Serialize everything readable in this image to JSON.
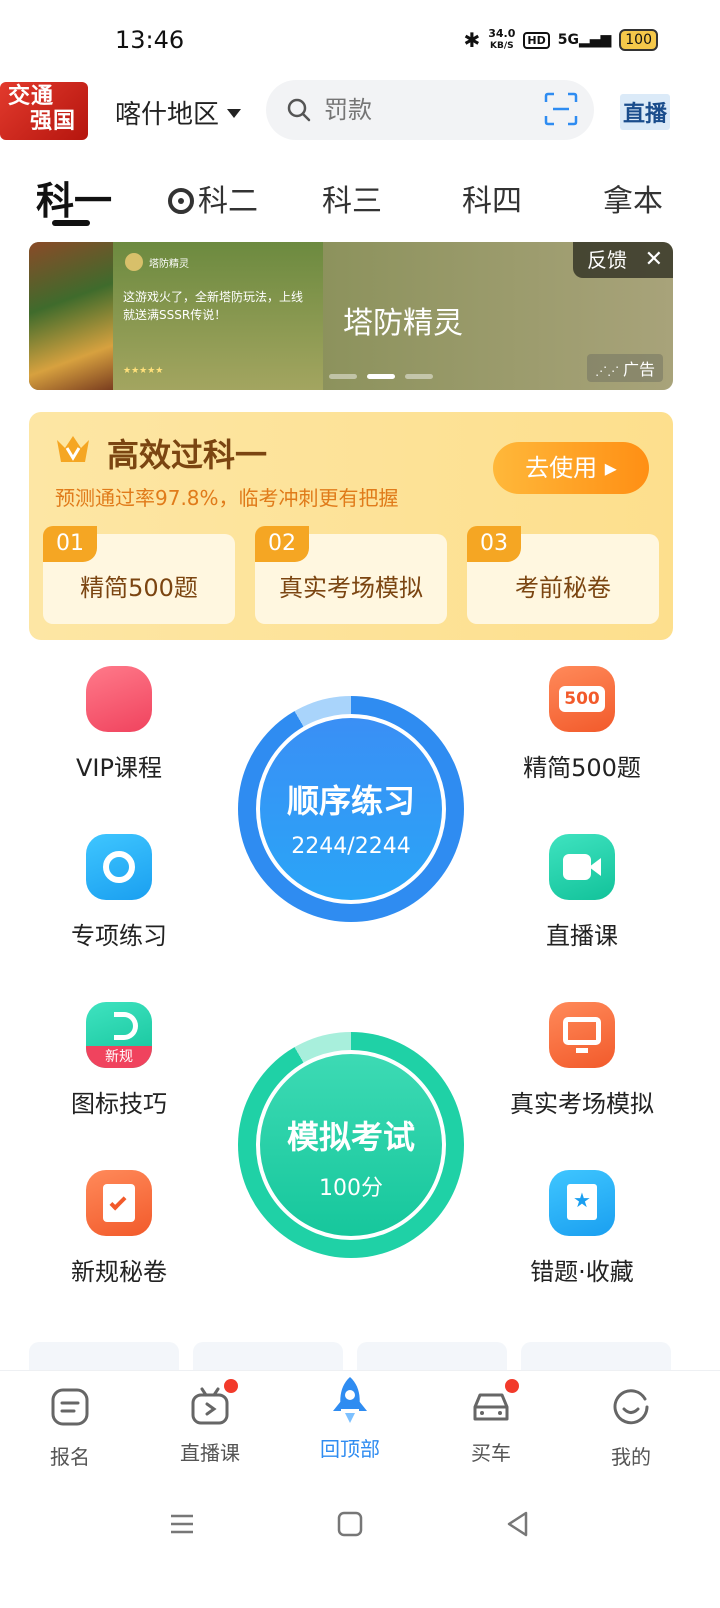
{
  "status_bar": {
    "time": "13:46",
    "speed_value": "34.0",
    "speed_unit": "KB/S",
    "hd": "HD",
    "network": "5G",
    "battery": "100"
  },
  "header": {
    "logo_line1": "交通",
    "logo_line2": "强国",
    "region": "喀什地区",
    "search_placeholder": "罚款",
    "live_label": "直播"
  },
  "tabs": [
    {
      "label": "科一",
      "active": true
    },
    {
      "label": "科二",
      "icon": "steering-wheel-icon"
    },
    {
      "label": "科三"
    },
    {
      "label": "科四"
    },
    {
      "label": "拿本"
    }
  ],
  "ad": {
    "app_name": "塔防精灵",
    "description": "这游戏火了，全新塔防玩法，上线就送满SSSR传说！",
    "stars": "★★★★★",
    "title": "塔防精灵",
    "feedback": "反馈",
    "close": "✕",
    "ad_label": "广告",
    "active_slide": 2
  },
  "efficiency": {
    "title": "高效过科一",
    "subtitle": "预测通过率97.8%，临考冲刺更有把握",
    "button": "去使用 ▸",
    "items": [
      {
        "num": "01",
        "label": "精简500题"
      },
      {
        "num": "02",
        "label": "真实考场模拟"
      },
      {
        "num": "03",
        "label": "考前秘卷"
      }
    ]
  },
  "features": {
    "vip": "VIP课程",
    "jingjian": "精简500题",
    "zhuanxiang": "专项练习",
    "zhibo": "直播课",
    "tubiao": "图标技巧",
    "tubiao_badge": "新规",
    "zhenshi": "真实考场模拟",
    "xingui": "新规秘卷",
    "cuoti": "错题·收藏",
    "badge_500": "500"
  },
  "practice": {
    "title": "顺序练习",
    "progress": "2244/2244"
  },
  "exam": {
    "title": "模拟考试",
    "score": "100分"
  },
  "bottom_nav": [
    {
      "label": "报名"
    },
    {
      "label": "直播课",
      "dot": true
    },
    {
      "label": "回顶部",
      "active": true
    },
    {
      "label": "买车",
      "dot": true
    },
    {
      "label": "我的"
    }
  ],
  "colors": {
    "accent": "#2f8cf1",
    "practice_blue": "#2f8cf1",
    "exam_green": "#1fd1a6",
    "warning_orange": "#f5a623"
  }
}
